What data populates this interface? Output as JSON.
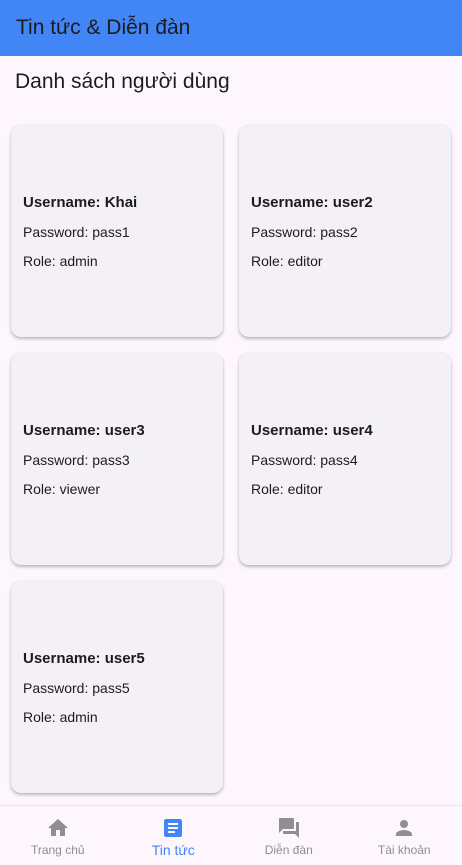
{
  "appbar": {
    "title": "Tin tức & Diễn đàn"
  },
  "page": {
    "section_title": "Danh sách người dùng"
  },
  "users": [
    {
      "username": "Username: Khai",
      "password": "Password: pass1",
      "role": "Role: admin"
    },
    {
      "username": "Username: user2",
      "password": "Password: pass2",
      "role": "Role: editor"
    },
    {
      "username": "Username: user3",
      "password": "Password: pass3",
      "role": "Role: viewer"
    },
    {
      "username": "Username: user4",
      "password": "Password: pass4",
      "role": "Role: editor"
    },
    {
      "username": "Username: user5",
      "password": "Password: pass5",
      "role": "Role: admin"
    }
  ],
  "bottom_nav": {
    "items": [
      {
        "label": "Trang chủ",
        "icon": "home-icon",
        "active": false
      },
      {
        "label": "Tin tức",
        "icon": "article-icon",
        "active": true
      },
      {
        "label": "Diễn đàn",
        "icon": "forum-icon",
        "active": false
      },
      {
        "label": "Tài khoản",
        "icon": "person-icon",
        "active": false
      }
    ]
  },
  "colors": {
    "accent": "#4285f4",
    "inactive": "#8e8e93",
    "background": "#fdf7fd",
    "card": "#f4f1f6"
  }
}
